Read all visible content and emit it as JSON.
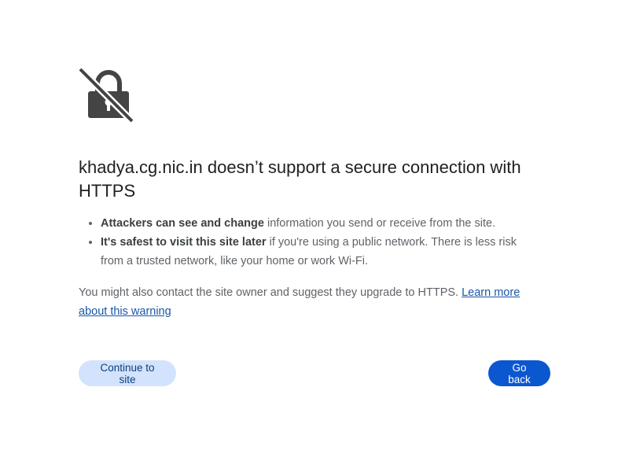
{
  "icon": {
    "name": "lock-broken-icon",
    "color": "#444444"
  },
  "title": "khadya.cg.nic.in doesn’t support a secure connection with HTTPS",
  "reasons": [
    {
      "bold": "Attackers can see and change",
      "text": " information you send or receive from the site."
    },
    {
      "bold": "It's safest to visit this site later",
      "text": " if you're using a public network. There is less risk from a trusted network, like your home or work Wi-Fi."
    }
  ],
  "contact": {
    "text": "You might also contact the site owner and suggest they upgrade to HTTPS. ",
    "link": "Learn more about this warning"
  },
  "buttons": {
    "continue": "Continue to site",
    "back": "Go back"
  },
  "colors": {
    "primary": "#0b57d0",
    "secondary_bg": "#d3e3fd",
    "link": "#1a56a8"
  }
}
